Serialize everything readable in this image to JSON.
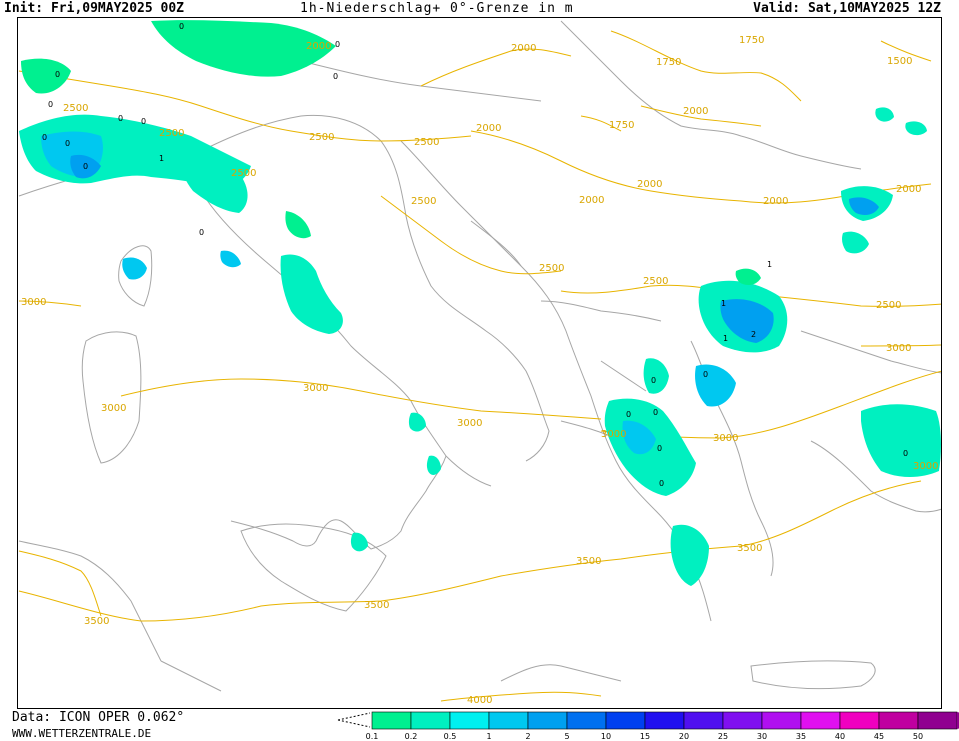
{
  "header": {
    "init": "Init: Fri,09MAY2025 00Z",
    "title": "1h-Niederschlag+ 0°-Grenze in m",
    "valid": "Valid: Sat,10MAY2025 12Z"
  },
  "footer": {
    "data_source": "Data: ICON OPER 0.062°",
    "website": "WWW.WETTERZENTRALE.DE"
  },
  "legend": {
    "ticks": [
      "0.1",
      "0.2",
      "0.5",
      "1",
      "2",
      "5",
      "10",
      "15",
      "20",
      "25",
      "30",
      "35",
      "40",
      "45",
      "50"
    ],
    "colors": [
      "#00f090",
      "#00f0c0",
      "#00f0f0",
      "#00c8f0",
      "#00a0f0",
      "#0070f0",
      "#0040f0",
      "#2010f0",
      "#5010f0",
      "#8010f0",
      "#b010f0",
      "#e010f0",
      "#f000c0",
      "#c000a0",
      "#900090"
    ]
  },
  "isolines": {
    "color": "#e8b400",
    "labels": [
      "2000",
      "1750",
      "1750",
      "1500",
      "2000",
      "1750",
      "2500",
      "2000",
      "2500",
      "2500",
      "2500",
      "2000",
      "2000",
      "2000",
      "2500",
      "2500",
      "2500",
      "3000",
      "3000",
      "3000",
      "3000",
      "3000",
      "3000",
      "3000",
      "3500",
      "3500",
      "3500",
      "3500",
      "4000",
      "2500",
      "2000",
      "3000",
      "2500",
      "2000"
    ]
  },
  "freezing_level_markers": [
    "0",
    "0",
    "0",
    "0",
    "0",
    "0",
    "0",
    "1",
    "0",
    "0",
    "0",
    "0",
    "1",
    "1",
    "1",
    "2",
    "0",
    "0",
    "0",
    "0",
    "0",
    "0",
    "0"
  ]
}
